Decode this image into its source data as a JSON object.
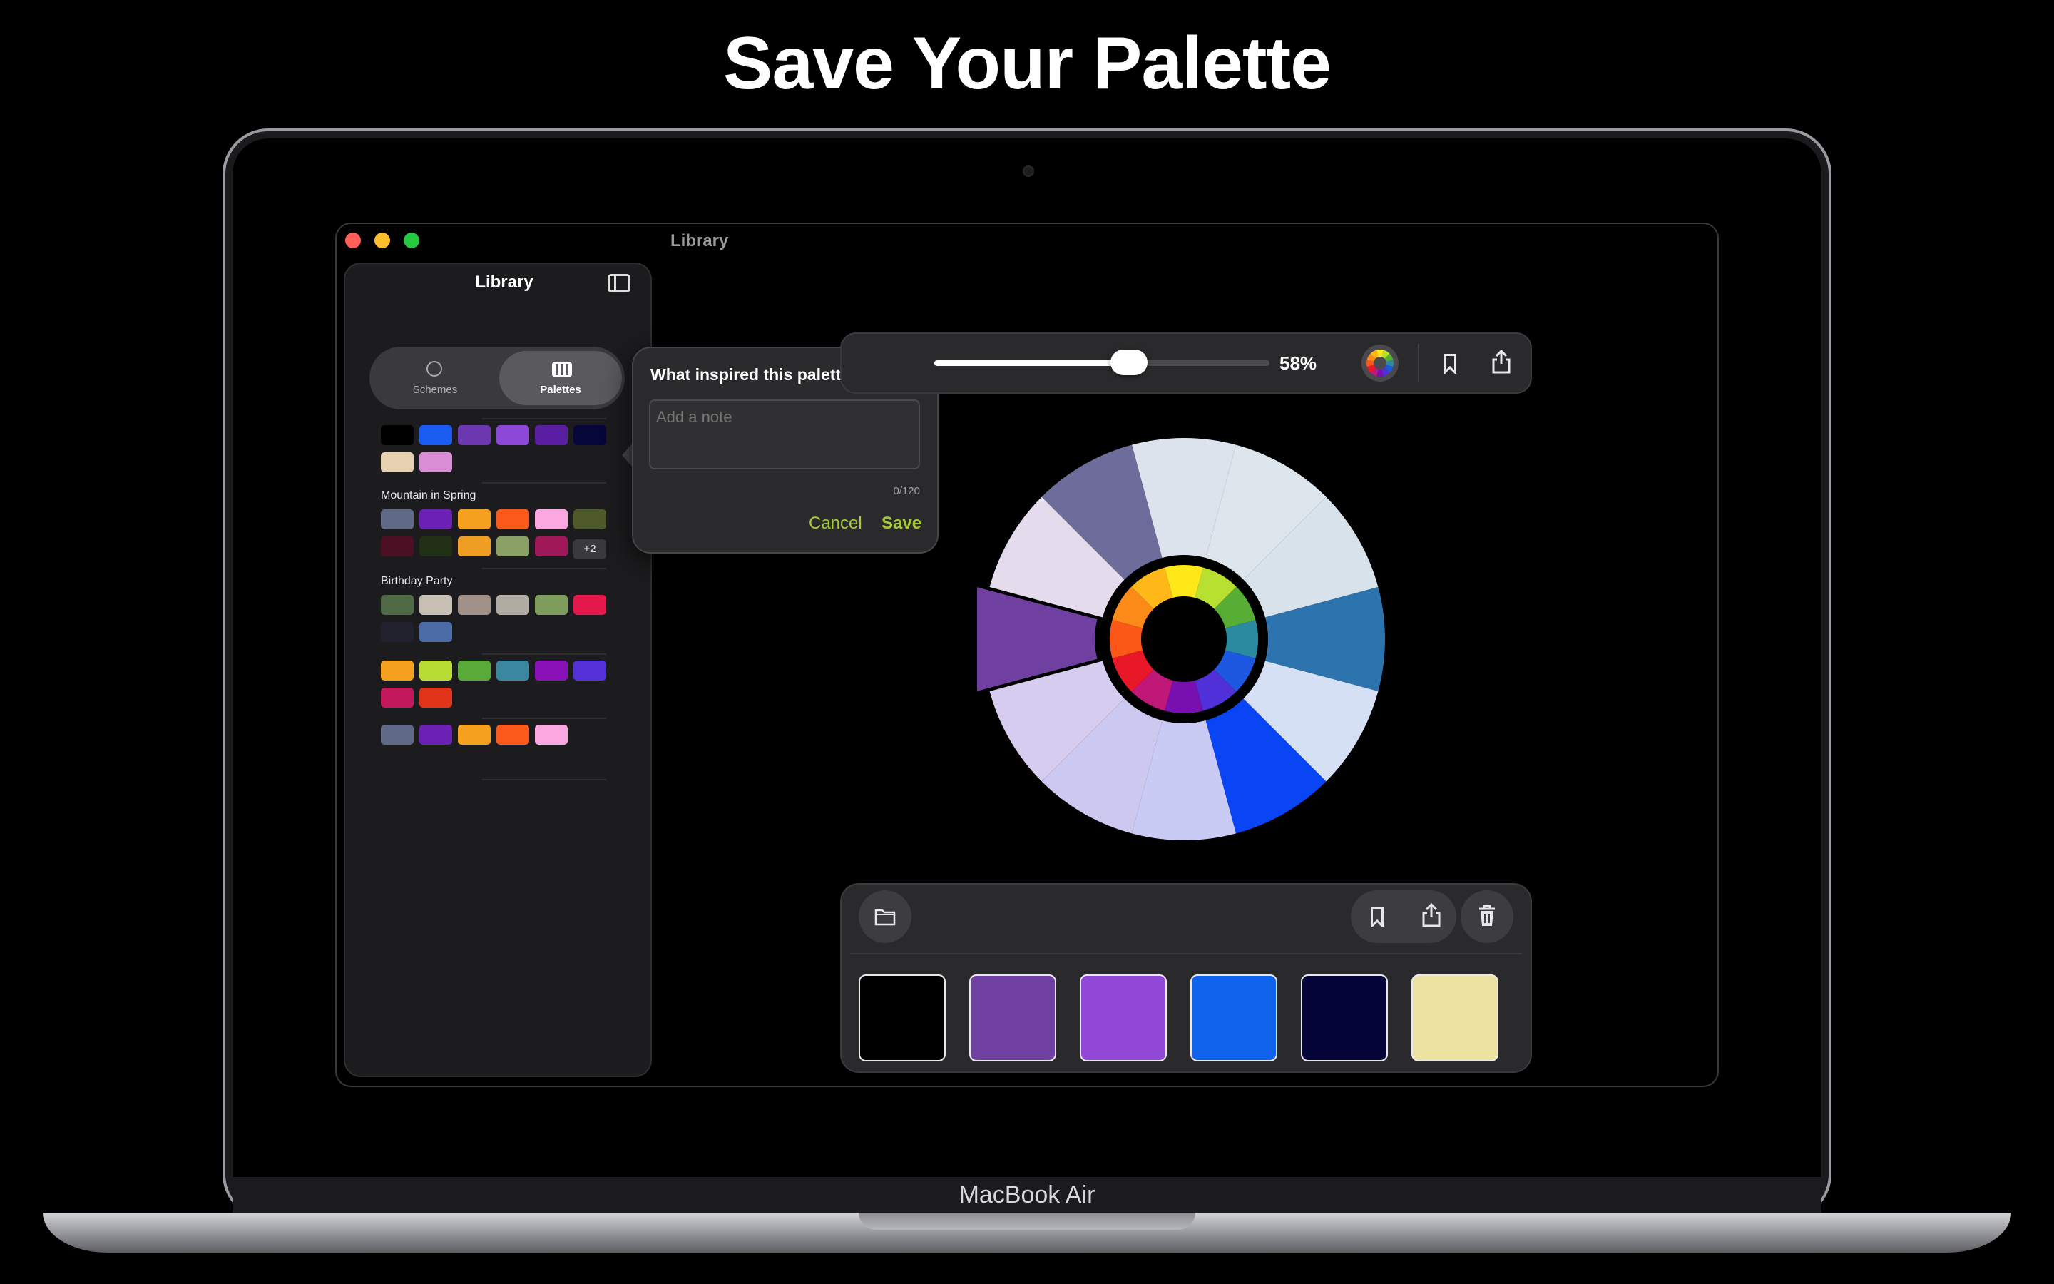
{
  "headline": "Save Your Palette",
  "device_label": "MacBook Air",
  "window": {
    "title": "Library"
  },
  "sidebar": {
    "title": "Library",
    "segments": [
      {
        "label": "Schemes",
        "selected": false
      },
      {
        "label": "Palettes",
        "selected": true
      }
    ],
    "groups": [
      {
        "title": "",
        "rows": [
          [
            "#000000",
            "#1a5cf0",
            "#6b38b0",
            "#8d48d8",
            "#5a1ea0",
            "#07063a"
          ],
          [
            "#e6d2b0",
            "#d88fd6"
          ]
        ]
      },
      {
        "title": "Mountain in Spring",
        "rows": [
          [
            "#5e6a86",
            "#6b22b4",
            "#f5a11f",
            "#fb5a1b",
            "#fca8e0",
            "#4e5a2a"
          ],
          [
            "#4c0f24",
            "#223016",
            "#ee9e22",
            "#8ba064",
            "#a01858"
          ]
        ],
        "more": "+2"
      },
      {
        "title": "Birthday Party",
        "rows": [
          [
            "#506a48",
            "#c8c0b4",
            "#a09088",
            "#b0aca4",
            "#7e9c5c",
            "#e4184c"
          ],
          [
            "#22222e",
            "#4c6ca8"
          ]
        ]
      },
      {
        "title": "",
        "rows": [
          [
            "#f5a11f",
            "#b8dc34",
            "#5aaa3a",
            "#3a88a0",
            "#8a10b8",
            "#5430d8"
          ],
          [
            "#c4185c",
            "#e03418"
          ]
        ]
      },
      {
        "title": "",
        "rows": [
          [
            "#5e6a86",
            "#6b22b4",
            "#f5a11f",
            "#fb5a1b",
            "#fca8e0"
          ]
        ]
      }
    ]
  },
  "popover": {
    "title": "What inspired this palette?",
    "placeholder": "Add a note",
    "counter": "0/120",
    "cancel_label": "Cancel",
    "save_label": "Save"
  },
  "toolbar": {
    "percent": 58,
    "percent_label": "58%",
    "icons": [
      "color-wheel-icon",
      "bookmark-icon",
      "share-icon"
    ]
  },
  "color_wheel": {
    "outer_segments": [
      "#dce3ec",
      "#dde6ed",
      "#d8e2ea",
      "#2d73ad",
      "#d5e0f5",
      "#0a45f5",
      "#c9cbf5",
      "#ccc8f0",
      "#d5ccf0",
      "#7040a0",
      "#e4dcec",
      "#6e6c9a"
    ],
    "selected_index": 9,
    "inner_segments": [
      "#ffe818",
      "#b8e030",
      "#58ae34",
      "#2a8aa0",
      "#1c58e0",
      "#5030d8",
      "#7810b0",
      "#c01878",
      "#e81828",
      "#fb5818",
      "#fb8a18",
      "#ffb818"
    ]
  },
  "bottom_panel": {
    "icons": [
      "folder-icon",
      "bookmark-icon",
      "share-icon",
      "trash-icon"
    ],
    "swatches": [
      "#000000",
      "#7040a0",
      "#9148d4",
      "#0f62ec",
      "#050438",
      "#ebe2a2"
    ]
  }
}
